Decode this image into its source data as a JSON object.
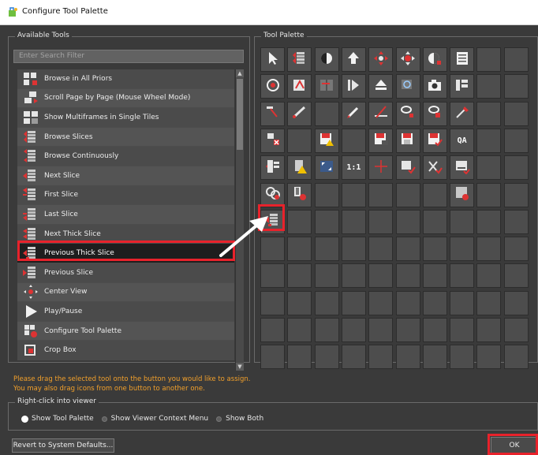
{
  "window": {
    "title": "Configure Tool Palette"
  },
  "available_tools": {
    "group_label": "Available Tools",
    "search_placeholder": "Enter Search Filter",
    "items": [
      {
        "label": "Browse in All Priors",
        "icon": "browse-priors-icon"
      },
      {
        "label": "Scroll Page by Page (Mouse Wheel Mode)",
        "icon": "scroll-page-icon"
      },
      {
        "label": "Show Multiframes in Single Tiles",
        "icon": "multiframes-icon"
      },
      {
        "label": "Browse Slices",
        "icon": "browse-slices-icon"
      },
      {
        "label": "Browse Continuously",
        "icon": "browse-continuously-icon"
      },
      {
        "label": "Next Slice",
        "icon": "next-slice-icon"
      },
      {
        "label": "First Slice",
        "icon": "first-slice-icon"
      },
      {
        "label": "Last Slice",
        "icon": "last-slice-icon"
      },
      {
        "label": "Next Thick Slice",
        "icon": "next-thick-slice-icon"
      },
      {
        "label": "Previous Thick Slice",
        "icon": "previous-thick-slice-icon",
        "selected": true
      },
      {
        "label": "Previous Slice",
        "icon": "previous-slice-icon"
      },
      {
        "label": "Center View",
        "icon": "center-view-icon"
      },
      {
        "label": "Play/Pause",
        "icon": "play-icon"
      },
      {
        "label": "Configure Tool Palette",
        "icon": "configure-palette-icon"
      },
      {
        "label": "Crop Box",
        "icon": "crop-box-icon"
      }
    ]
  },
  "tool_palette": {
    "group_label": "Tool Palette",
    "rows": [
      [
        "pointer-icon",
        "browse-slices-icon",
        "contrast-icon",
        "pan-up-icon",
        "move-icon",
        "zoom-icon",
        "window-level-icon",
        "list-icon",
        "",
        ""
      ],
      [
        "target-icon",
        "rotate-icon",
        "sync-icon",
        "cine-icon",
        "eject-icon",
        "magnify-icon",
        "camera-icon",
        "layout-icon",
        "",
        ""
      ],
      [
        "measure-icon",
        "ruler-icon",
        "",
        "pencil-icon",
        "angle-icon",
        "ellipse-icon",
        "roi-icon",
        "pipette-icon",
        "",
        ""
      ],
      [
        "cut-icon",
        "",
        "save-warning-icon",
        "",
        "save-pr-icon",
        "save-icon",
        "save-check-icon",
        "qa-text",
        "",
        ""
      ],
      [
        "tile-icon",
        "warning-icon",
        "fit-icon",
        "1to1-text",
        "crosshair-icon",
        "export-icon",
        "reject-icon",
        "minimize-icon",
        "",
        ""
      ],
      [
        "link-icon",
        "print-icon",
        "",
        "",
        "",
        "",
        "",
        "delete-icon",
        "",
        ""
      ],
      [
        "previous-thick-slice-icon",
        "",
        "",
        "",
        "",
        "",
        "",
        "",
        "",
        ""
      ],
      [
        "",
        "",
        "",
        "",
        "",
        "",
        "",
        "",
        "",
        ""
      ],
      [
        "",
        "",
        "",
        "",
        "",
        "",
        "",
        "",
        "",
        ""
      ],
      [
        "",
        "",
        "",
        "",
        "",
        "",
        "",
        "",
        "",
        ""
      ],
      [
        "",
        "",
        "",
        "",
        "",
        "",
        "",
        "",
        "",
        ""
      ],
      [
        "",
        "",
        "",
        "",
        "",
        "",
        "",
        "",
        "",
        ""
      ]
    ],
    "text_cells": {
      "qa-text": "QA",
      "1to1-text": "1:1"
    }
  },
  "instructions": {
    "line1": "Please drag the selected tool onto the button you would like to assign.",
    "line2": "You may also drag icons from one button to another one."
  },
  "right_click": {
    "group_label": "Right-click into viewer",
    "options": [
      {
        "label": "Show Tool Palette",
        "selected": true
      },
      {
        "label": "Show Viewer Context Menu",
        "selected": false
      },
      {
        "label": "Show Both",
        "selected": false
      }
    ]
  },
  "buttons": {
    "revert": "Revert to System Defaults...",
    "ok": "OK"
  },
  "colors": {
    "highlight": "#e8222b",
    "hint_text": "#f2a02b",
    "background": "#3a3a3a"
  }
}
